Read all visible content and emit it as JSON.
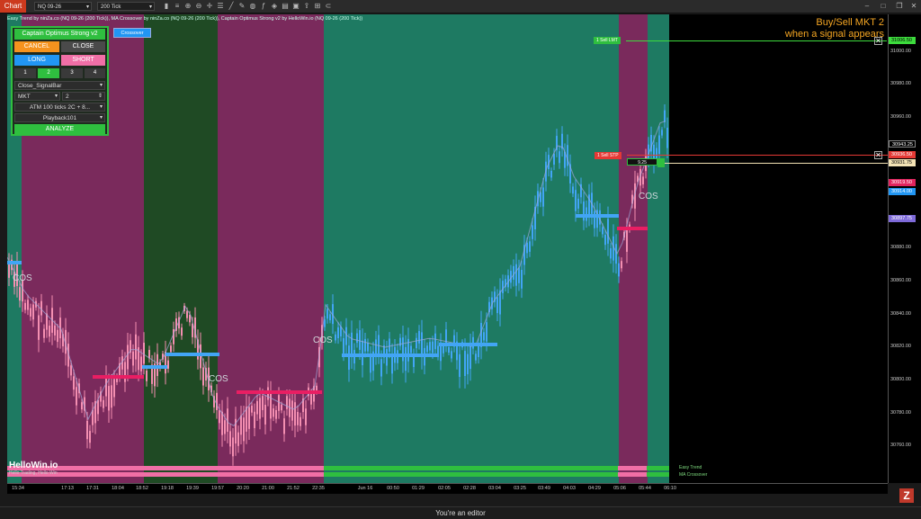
{
  "toolbar": {
    "chart_tab": "Chart",
    "instrument": "NQ 09-26",
    "interval": "200 Tick"
  },
  "header": {
    "indicators": "Easy Trend by ninZa.co (NQ 09-26 (200 Tick)), MA Crossover by ninZa.co (NQ 09-26 (200 Tick)), Captain Optimus Strong v2 by HelloWin.io (NQ 09-26 (200 Tick))"
  },
  "note": {
    "line1": "Buy/Sell MKT 2",
    "line2": "when a signal appears"
  },
  "panel": {
    "title": "Captain Optimus Strong v2",
    "cancel": "CANCEL",
    "close": "CLOSE",
    "long": "LONG",
    "short": "SHORT",
    "tabs": [
      "1",
      "2",
      "3",
      "4"
    ],
    "mode": "Close_SignalBar",
    "order_type": "MKT",
    "quantity": "2",
    "atm": "ATM 100 ticks 2C + 8...",
    "account": "Playback101",
    "analyze": "ANALYZE",
    "colors": {
      "cancel": "#f5931e",
      "close": "#4a4a4a",
      "long": "#2196f3",
      "short": "#f06fa6",
      "analyze": "#2fbf3f"
    }
  },
  "crossover": "Crossover",
  "orders": {
    "sell_lmt": "1  Sell  LMT",
    "sell_stp": "1  Sell  STP",
    "pnl": "9.25"
  },
  "cos_labels": [
    "COS",
    "COS",
    "COS",
    "COS"
  ],
  "y_labels": [
    "31000.00",
    "30980.00",
    "30960.00",
    "30860.00",
    "30840.00",
    "30820.00",
    "30800.00",
    "30780.00",
    "30760.00",
    "30880.00"
  ],
  "price_tags": [
    {
      "label": "31006.50",
      "color": "#3ddc3d",
      "text": "#000"
    },
    {
      "label": "30943.25",
      "color": "#000",
      "text": "#fff"
    },
    {
      "label": "30936.50",
      "color": "#e53935",
      "text": "#fff"
    },
    {
      "label": "30931.75",
      "color": "#f3e3b5",
      "text": "#000"
    },
    {
      "label": "30919.50",
      "color": "#e0245e",
      "text": "#fff"
    },
    {
      "label": "30914.00",
      "color": "#2196f3",
      "text": "#fff"
    },
    {
      "label": "30897.75",
      "color": "#7e6ad9",
      "text": "#fff"
    }
  ],
  "x_labels": [
    "15:34",
    "17:13",
    "17:31",
    "18:04",
    "18:52",
    "19:18",
    "19:39",
    "19:57",
    "20:20",
    "21:00",
    "21:52",
    "22:35",
    "Jun 16",
    "00:50",
    "01:29",
    "02:05",
    "02:28",
    "03:04",
    "03:25",
    "03:49",
    "04:03",
    "04:29",
    "05:06",
    "05:44",
    "06:10"
  ],
  "legend": {
    "easy_trend": "Easy Trend",
    "ma_crossover": "MA Crossover"
  },
  "brand": {
    "name": "HelloWin.io",
    "tagline": "Hello Trading, Hello Win"
  },
  "status": "You're an editor",
  "z_logo": "Z"
}
